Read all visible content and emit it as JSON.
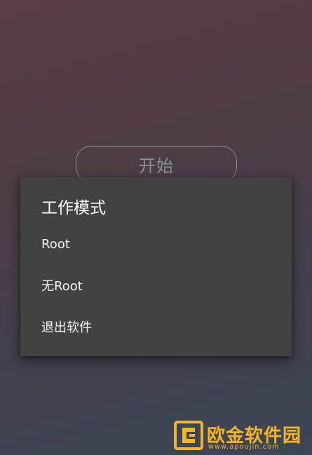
{
  "main": {
    "start_button_label": "开始"
  },
  "dialog": {
    "title": "工作模式",
    "items": [
      {
        "label": "Root"
      },
      {
        "label": "无Root"
      },
      {
        "label": "退出软件"
      }
    ]
  },
  "watermark": {
    "name": "欧金软件园",
    "url": "www.apoujin.com",
    "color": "#f1b52b"
  }
}
